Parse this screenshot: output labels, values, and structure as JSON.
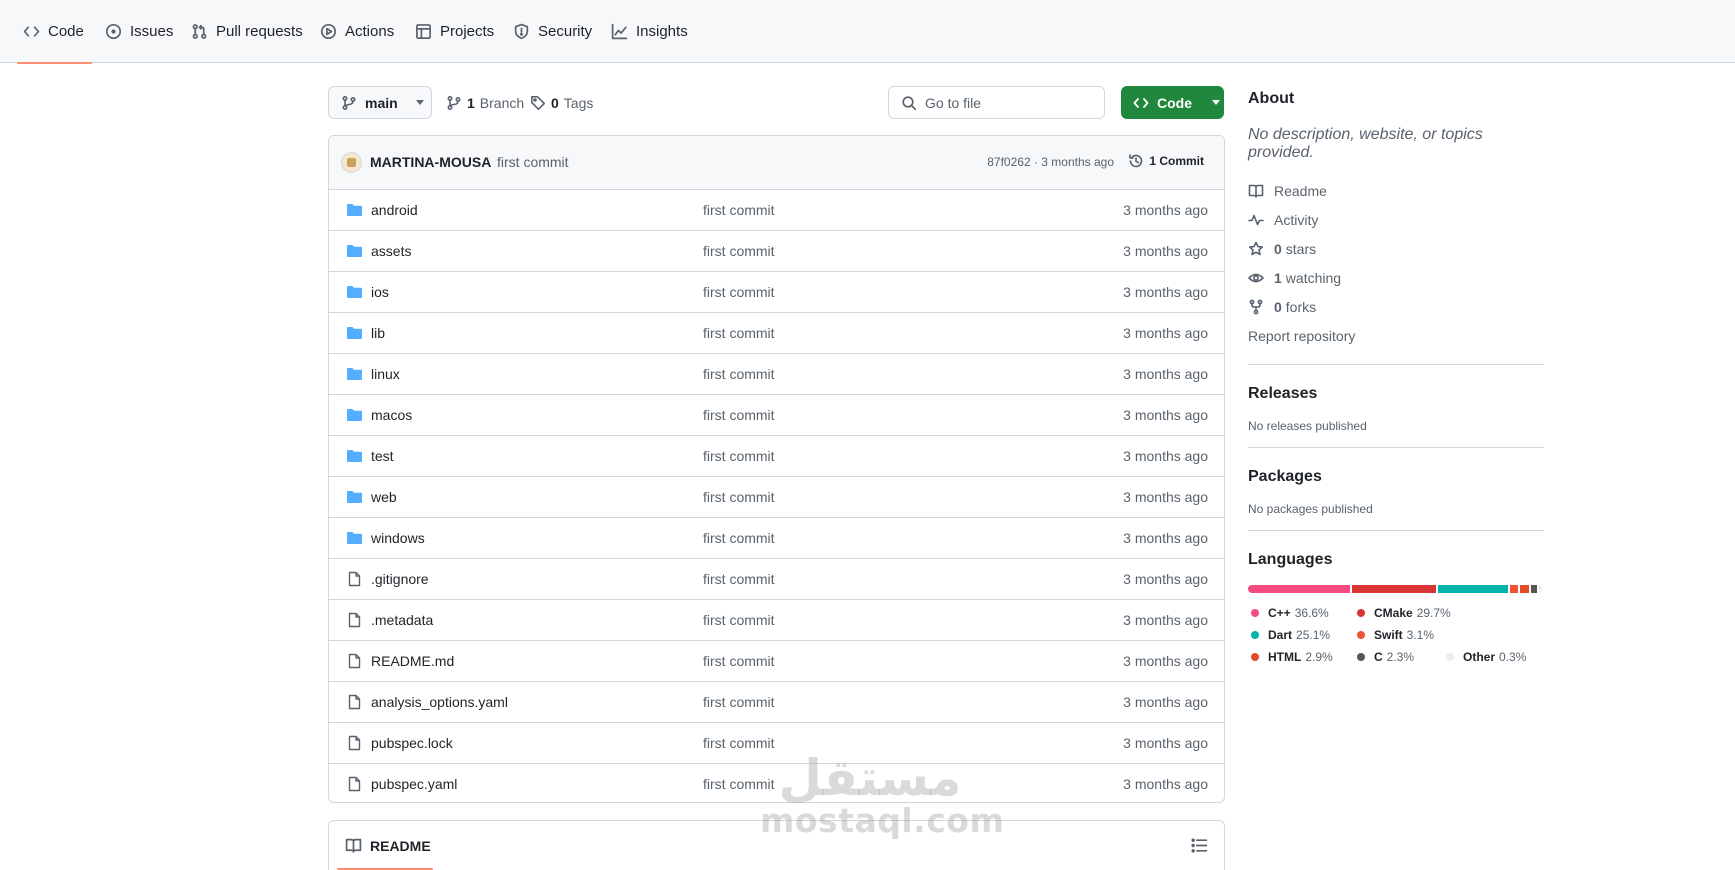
{
  "nav": {
    "tabs": [
      {
        "label": "Code",
        "icon": "code-icon",
        "active": true
      },
      {
        "label": "Issues",
        "icon": "issue-icon"
      },
      {
        "label": "Pull requests",
        "icon": "pull-request-icon"
      },
      {
        "label": "Actions",
        "icon": "play-icon"
      },
      {
        "label": "Projects",
        "icon": "table-icon"
      },
      {
        "label": "Security",
        "icon": "shield-icon"
      },
      {
        "label": "Insights",
        "icon": "graph-icon"
      }
    ]
  },
  "toolbar": {
    "branch": "main",
    "branches_count": "1",
    "branches_label": "Branch",
    "tags_count": "0",
    "tags_label": "Tags",
    "search_placeholder": "Go to file",
    "code_button": "Code"
  },
  "commit": {
    "author": "MARTINA-MOUSA",
    "message": "first commit",
    "meta": "87f0262 · 3 months ago",
    "count_label": "1 Commit"
  },
  "files": [
    {
      "name": "android",
      "type": "dir",
      "message": "first commit",
      "age": "3 months ago"
    },
    {
      "name": "assets",
      "type": "dir",
      "message": "first commit",
      "age": "3 months ago"
    },
    {
      "name": "ios",
      "type": "dir",
      "message": "first commit",
      "age": "3 months ago"
    },
    {
      "name": "lib",
      "type": "dir",
      "message": "first commit",
      "age": "3 months ago"
    },
    {
      "name": "linux",
      "type": "dir",
      "message": "first commit",
      "age": "3 months ago"
    },
    {
      "name": "macos",
      "type": "dir",
      "message": "first commit",
      "age": "3 months ago"
    },
    {
      "name": "test",
      "type": "dir",
      "message": "first commit",
      "age": "3 months ago"
    },
    {
      "name": "web",
      "type": "dir",
      "message": "first commit",
      "age": "3 months ago"
    },
    {
      "name": "windows",
      "type": "dir",
      "message": "first commit",
      "age": "3 months ago"
    },
    {
      "name": ".gitignore",
      "type": "file",
      "message": "first commit",
      "age": "3 months ago"
    },
    {
      "name": ".metadata",
      "type": "file",
      "message": "first commit",
      "age": "3 months ago"
    },
    {
      "name": "README.md",
      "type": "file",
      "message": "first commit",
      "age": "3 months ago"
    },
    {
      "name": "analysis_options.yaml",
      "type": "file",
      "message": "first commit",
      "age": "3 months ago"
    },
    {
      "name": "pubspec.lock",
      "type": "file",
      "message": "first commit",
      "age": "3 months ago"
    },
    {
      "name": "pubspec.yaml",
      "type": "file",
      "message": "first commit",
      "age": "3 months ago"
    }
  ],
  "readme": {
    "label": "README"
  },
  "about": {
    "title": "About",
    "description": "No description, website, or topics provided.",
    "readme": "Readme",
    "activity": "Activity",
    "stars_count": "0",
    "stars_label": "stars",
    "watching_count": "1",
    "watching_label": "watching",
    "forks_count": "0",
    "forks_label": "forks",
    "report": "Report repository"
  },
  "releases": {
    "title": "Releases",
    "empty": "No releases published"
  },
  "packages": {
    "title": "Packages",
    "empty": "No packages published"
  },
  "languages": {
    "title": "Languages",
    "items": [
      {
        "name": "C++",
        "pct": "36.6%",
        "value": 36.6,
        "color": "#f34b7d"
      },
      {
        "name": "CMake",
        "pct": "29.7%",
        "value": 29.7,
        "color": "#da3434"
      },
      {
        "name": "Dart",
        "pct": "25.1%",
        "value": 25.1,
        "color": "#00b4ab"
      },
      {
        "name": "Swift",
        "pct": "3.1%",
        "value": 3.1,
        "color": "#f05138"
      },
      {
        "name": "HTML",
        "pct": "2.9%",
        "value": 2.9,
        "color": "#e34c26"
      },
      {
        "name": "C",
        "pct": "2.3%",
        "value": 2.3,
        "color": "#555555"
      },
      {
        "name": "Other",
        "pct": "0.3%",
        "value": 0.3,
        "color": "#ededed"
      }
    ]
  },
  "watermark": {
    "arabic": "مستقل",
    "latin": "mostaql.com"
  },
  "colors": {
    "accent_green": "#1f883d",
    "tab_underline": "#fd8c73",
    "folder_blue": "#54aeff"
  }
}
